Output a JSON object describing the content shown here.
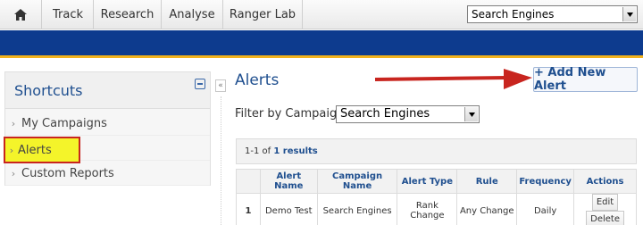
{
  "nav": {
    "items": [
      "Track",
      "Research",
      "Analyse",
      "Ranger Lab"
    ],
    "campaign_select": "Search Engines"
  },
  "sidebar": {
    "title": "Shortcuts",
    "items": [
      {
        "label": "My Campaigns"
      },
      {
        "label": "Alerts"
      },
      {
        "label": "Custom Reports"
      }
    ]
  },
  "main": {
    "title": "Alerts",
    "add_button": "+ Add New Alert",
    "filter_label": "Filter by Campaign:",
    "filter_value": "Search Engines",
    "results_prefix": "1-1 of",
    "results_link": "1 results",
    "table": {
      "headers": [
        "",
        "Alert Name",
        "Campaign Name",
        "Alert Type",
        "Rule",
        "Frequency",
        "Actions"
      ],
      "rows": [
        {
          "num": "1",
          "name": "Demo Test",
          "campaign": "Search Engines",
          "type": "Rank Change",
          "rule": "Any Change",
          "frequency": "Daily",
          "edit": "Edit",
          "delete": "Delete"
        }
      ]
    }
  },
  "colors": {
    "brand_blue": "#0d3b8e",
    "accent_gold": "#f2b21c",
    "highlight_yellow": "#f4f42a",
    "annotation_red": "#c8251f"
  }
}
